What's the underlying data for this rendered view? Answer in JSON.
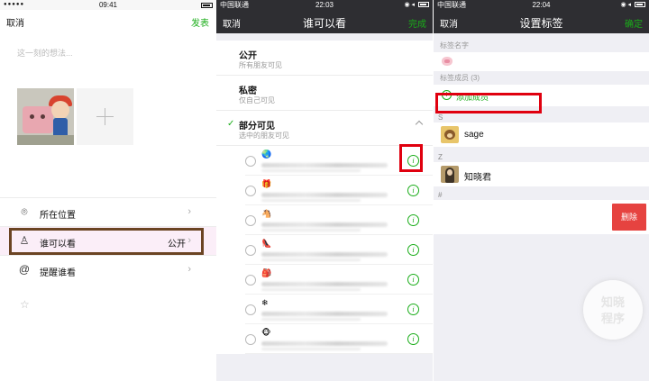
{
  "panel1": {
    "status_time": "09:41",
    "cancel": "取消",
    "publish": "发表",
    "placeholder": "这一刻的想法...",
    "rows": [
      {
        "label": "所在位置",
        "value": ""
      },
      {
        "label": "谁可以看",
        "value": "公开"
      },
      {
        "label": "提醒谁看",
        "value": ""
      }
    ]
  },
  "panel2": {
    "carrier": "中国联通",
    "status_time": "22:03",
    "cancel": "取消",
    "title": "谁可以看",
    "done": "完成",
    "options": [
      {
        "title": "公开",
        "subtitle": "所有朋友可见"
      },
      {
        "title": "私密",
        "subtitle": "仅自己可见"
      },
      {
        "title": "部分可见",
        "subtitle": "选中的朋友可见"
      }
    ],
    "friends": [
      "🌏",
      "🎁",
      "🐴",
      "👠",
      "🎒",
      "❄",
      "🐵"
    ]
  },
  "panel3": {
    "carrier": "中国联通",
    "status_time": "22:04",
    "cancel": "取消",
    "title": "设置标签",
    "confirm": "确定",
    "tag_name_label": "标签名字",
    "members_label": "标签成员 (3)",
    "add_member": "添加成员",
    "groups": [
      {
        "letter": "S",
        "members": [
          "sage"
        ]
      },
      {
        "letter": "Z",
        "members": [
          "知晓君"
        ]
      },
      {
        "letter": "#",
        "members": []
      }
    ],
    "delete": "删除",
    "watermark_top": "知晓",
    "watermark_bottom": "程序"
  },
  "colors": {
    "wechat_green": "#1aad19",
    "nav_dark": "#2e2e32",
    "highlight_red": "#e0000f",
    "highlight_brown": "#6b4423",
    "delete_red": "#e64340"
  }
}
